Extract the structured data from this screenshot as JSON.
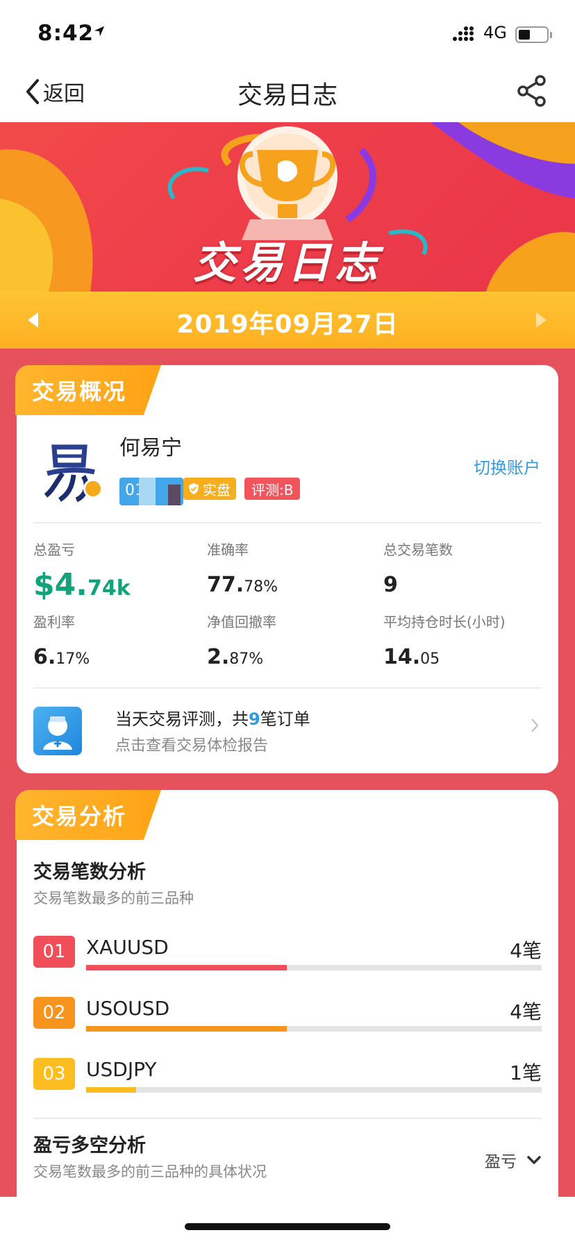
{
  "status_bar": {
    "time": "8:42",
    "network": "4G"
  },
  "nav": {
    "back_label": "返回",
    "title": "交易日志"
  },
  "banner": {
    "title": "交易日志"
  },
  "date_bar": {
    "date": "2019年09月27日"
  },
  "overview": {
    "tab_label": "交易概况",
    "user_name": "何易宁",
    "account_id": "01",
    "badge_real": "实盘",
    "badge_rating": "评测:B",
    "switch_account": "切换账户",
    "stats": [
      {
        "label": "总盈亏",
        "value_main": "$4.",
        "value_small": "74k"
      },
      {
        "label": "准确率",
        "value_main": "77.",
        "value_small": "78%"
      },
      {
        "label": "总交易笔数",
        "value_main": "9",
        "value_small": ""
      },
      {
        "label": "盈利率",
        "value_main": "6.",
        "value_small": "17%"
      },
      {
        "label": "净值回撤率",
        "value_main": "2.",
        "value_small": "87%"
      },
      {
        "label": "平均持仓时长(小时)",
        "value_main": "14.",
        "value_small": "05"
      }
    ],
    "report": {
      "title_prefix": "当天交易评测，共",
      "order_count": "9",
      "title_suffix": "笔订单",
      "subtitle": "点击查看交易体检报告"
    }
  },
  "analysis": {
    "tab_label": "交易分析",
    "count_title": "交易笔数分析",
    "count_subtitle": "交易笔数最多的前三品种",
    "ranks": [
      {
        "rank": "01",
        "symbol": "XAUUSD",
        "count": "4笔",
        "share": 0.44,
        "color": "#f04f5a"
      },
      {
        "rank": "02",
        "symbol": "USOUSD",
        "count": "4笔",
        "share": 0.44,
        "color": "#f7941d"
      },
      {
        "rank": "03",
        "symbol": "USDJPY",
        "count": "1笔",
        "share": 0.11,
        "color": "#fbbd1f"
      }
    ],
    "pl_title": "盈亏多空分析",
    "pl_subtitle": "交易笔数最多的前三品种的具体状况",
    "pl_dropdown": "盈亏"
  },
  "colors": {
    "accent_blue": "#2f9be0",
    "profit_green": "#12a37b",
    "brand_red": "#e5525b",
    "tab_orange": "#ffa316"
  }
}
